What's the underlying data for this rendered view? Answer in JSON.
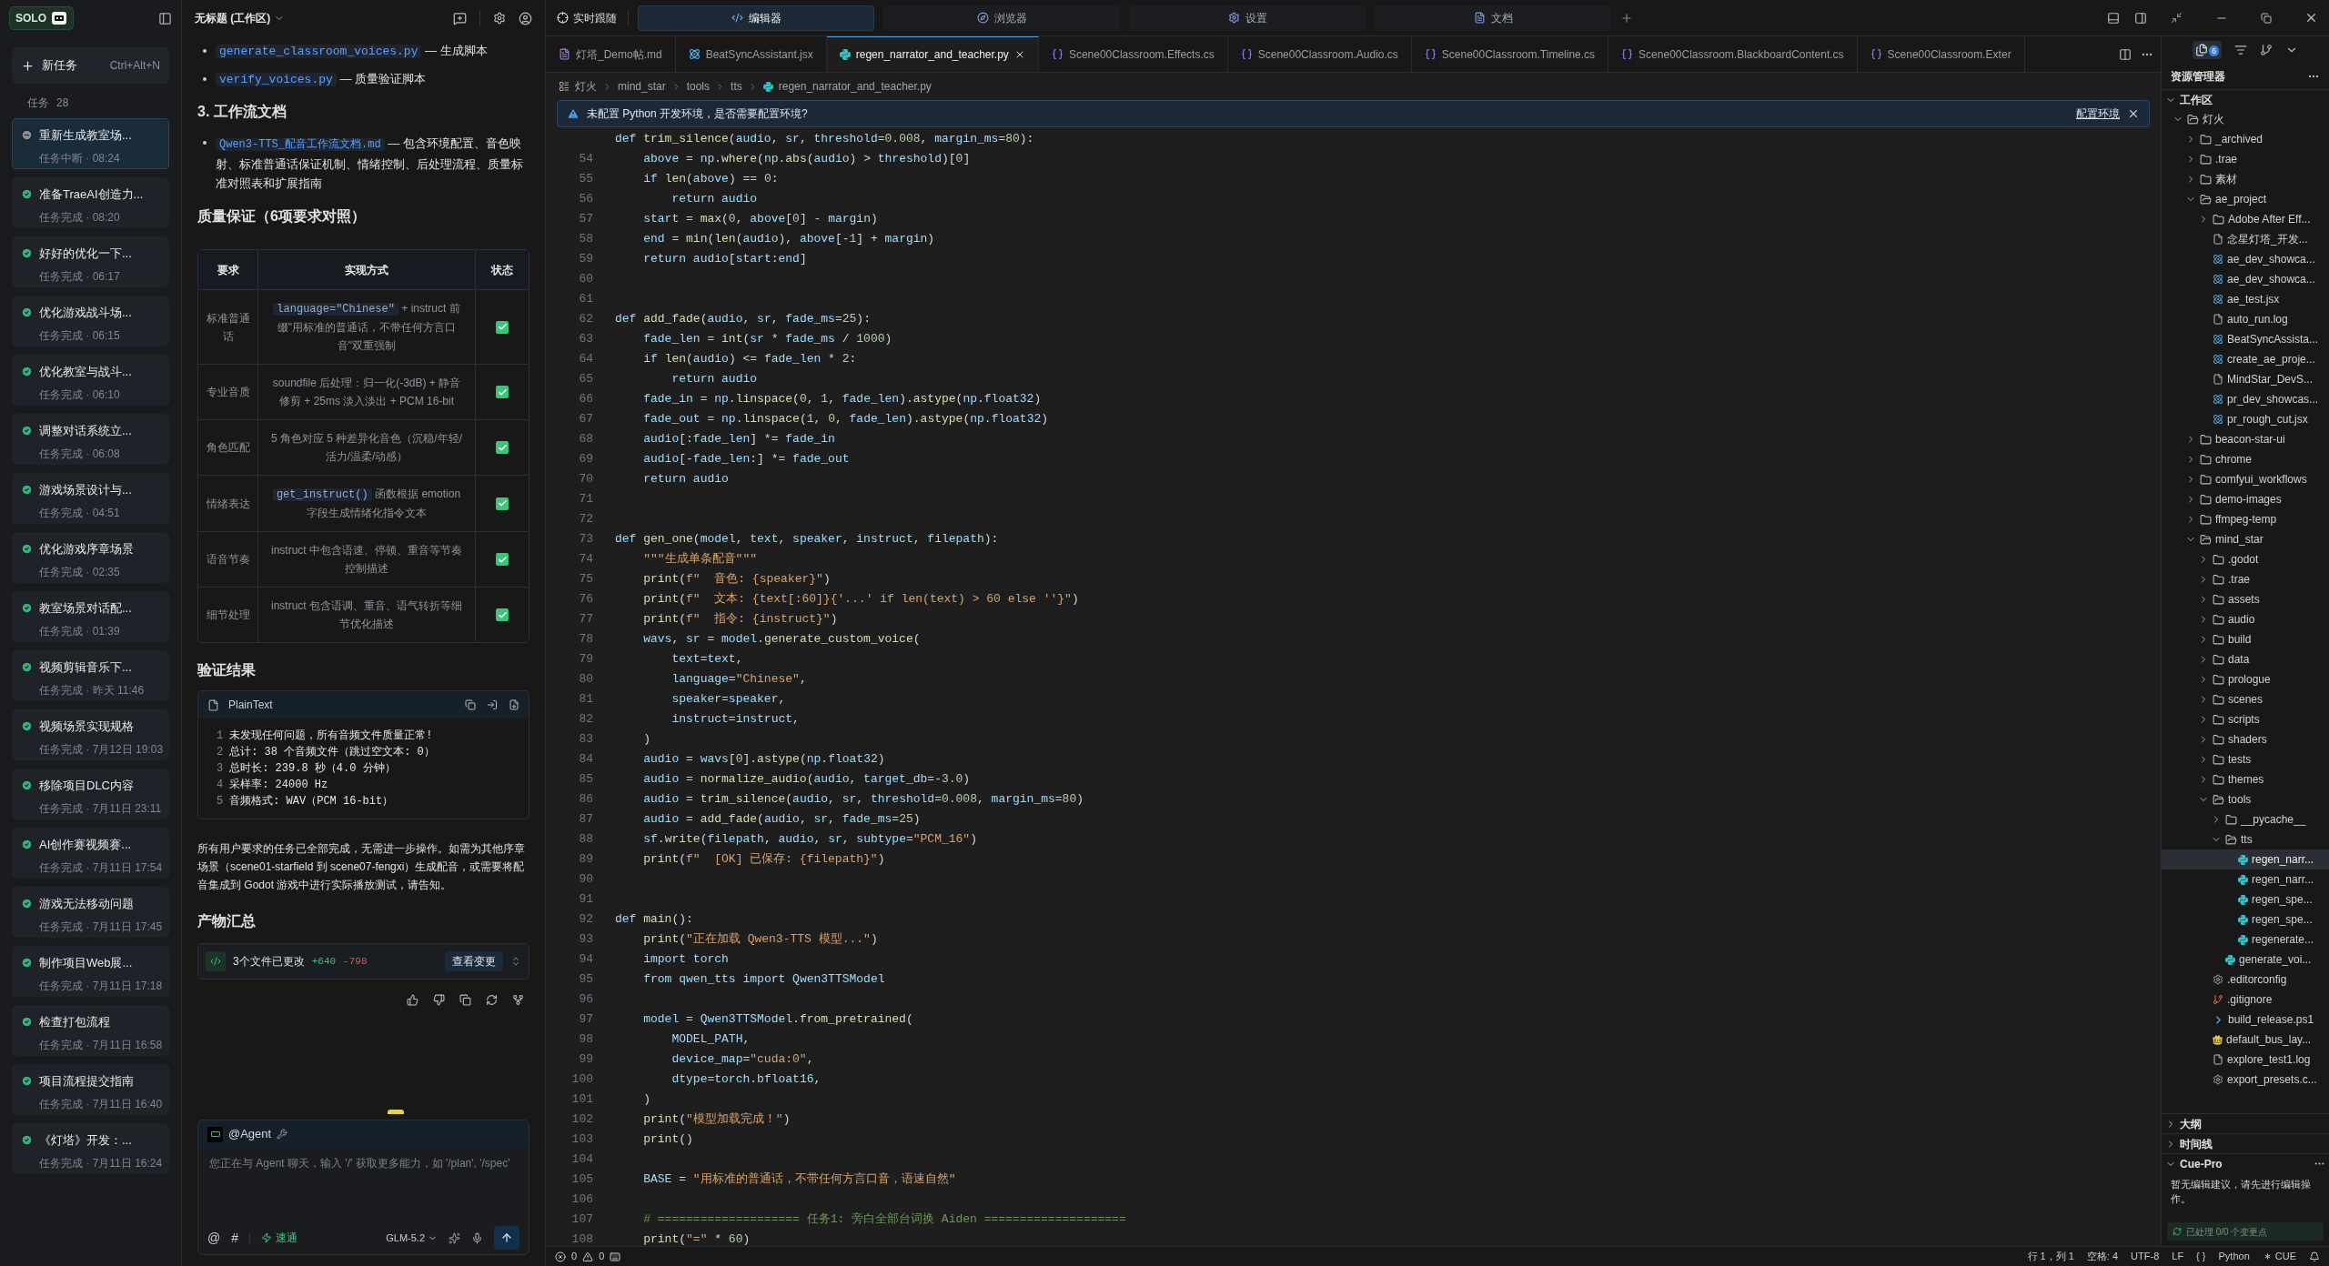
{
  "sidebar": {
    "logo": "SOLO",
    "new_task": {
      "label": "新任务",
      "shortcut": "Ctrl+Alt+N"
    },
    "tasks_label": "任务",
    "tasks_count": "28",
    "tasks": [
      {
        "title": "重新生成教室场...",
        "subtitle": "任务中断 · 08:24",
        "kind": "interrupted",
        "selected": true
      },
      {
        "title": "准备TraeAI创造力...",
        "subtitle": "任务完成 · 08:20",
        "kind": "done",
        "selected": false
      },
      {
        "title": "好好的优化一下...",
        "subtitle": "任务完成 · 06:17",
        "kind": "done",
        "selected": false
      },
      {
        "title": "优化游戏战斗场...",
        "subtitle": "任务完成 · 06:15",
        "kind": "done",
        "selected": false
      },
      {
        "title": "优化教室与战斗...",
        "subtitle": "任务完成 · 06:10",
        "kind": "done",
        "selected": false
      },
      {
        "title": "调整对话系统立...",
        "subtitle": "任务完成 · 06:08",
        "kind": "done",
        "selected": false
      },
      {
        "title": "游戏场景设计与...",
        "subtitle": "任务完成 · 04:51",
        "kind": "done",
        "selected": false
      },
      {
        "title": "优化游戏序章场景",
        "subtitle": "任务完成 · 02:35",
        "kind": "done",
        "selected": false
      },
      {
        "title": "教室场景对话配...",
        "subtitle": "任务完成 · 01:39",
        "kind": "done",
        "selected": false
      },
      {
        "title": "视频剪辑音乐下...",
        "subtitle": "任务完成 · 昨天 11:46",
        "kind": "done",
        "selected": false
      },
      {
        "title": "视频场景实现规格",
        "subtitle": "任务完成 · 7月12日 19:03",
        "kind": "done",
        "selected": false
      },
      {
        "title": "移除项目DLC内容",
        "subtitle": "任务完成 · 7月11日 23:11",
        "kind": "done",
        "selected": false
      },
      {
        "title": "AI创作赛视频赛...",
        "subtitle": "任务完成 · 7月11日 17:54",
        "kind": "done",
        "selected": false
      },
      {
        "title": "游戏无法移动问题",
        "subtitle": "任务完成 · 7月11日 17:45",
        "kind": "done",
        "selected": false
      },
      {
        "title": "制作项目Web展...",
        "subtitle": "任务完成 · 7月11日 17:18",
        "kind": "done",
        "selected": false
      },
      {
        "title": "检查打包流程",
        "subtitle": "任务完成 · 7月11日 16:58",
        "kind": "done",
        "selected": false
      },
      {
        "title": "项目流程提交指南",
        "subtitle": "任务完成 · 7月11日 16:40",
        "kind": "done",
        "selected": false
      },
      {
        "title": "《灯塔》开发：...",
        "subtitle": "任务完成 · 7月11日 16:24",
        "kind": "done",
        "selected": false
      }
    ]
  },
  "chat": {
    "title": "无标题 (工作区)",
    "script_bullets": [
      {
        "code": "generate_classroom_voices.py",
        "text": "— 生成脚本"
      },
      {
        "code": "verify_voices.py",
        "text": "— 质量验证脚本"
      }
    ],
    "docs_heading": "3. 工作流文档",
    "doc_bullets": [
      {
        "code": "Qwen3-TTS_配音工作流文档.md",
        "text": "— 包含环境配置、音色映射、标准普通话保证机制、情绪控制、后处理流程、质量标准对照表和扩展指南"
      }
    ],
    "qa_heading": "质量保证（6项要求对照）",
    "table": {
      "columns": [
        "要求",
        "实现方式",
        "状态"
      ],
      "rows": [
        {
          "requirement": "标准普通话",
          "code": "language=\"Chinese\"",
          "method": " + instruct 前缀\"用标准的普通话，不带任何方言口音\"双重强制",
          "checked": true
        },
        {
          "requirement": "专业音质",
          "method": "soundfile 后处理：归一化(-3dB) + 静音修剪 + 25ms 淡入淡出 + PCM 16-bit",
          "checked": true
        },
        {
          "requirement": "角色匹配",
          "method": "5 角色对应 5 种差异化音色（沉稳/年轻/活力/温柔/动感）",
          "checked": true
        },
        {
          "requirement": "情绪表达",
          "code": "get_instruct()",
          "method": " 函数根据 emotion 字段生成情绪化指令文本",
          "checked": true
        },
        {
          "requirement": "语音节奏",
          "method": "instruct 中包含语速、停顿、重音等节奏控制描述",
          "checked": true
        },
        {
          "requirement": "细节处理",
          "method": "instruct 包含语调、重音、语气转折等细节优化描述",
          "checked": true
        }
      ]
    },
    "verify_heading": "验证结果",
    "code_block": {
      "language": "PlainText",
      "lines": [
        {
          "number": "1",
          "text": "未发现任何问题，所有音频文件质量正常!"
        },
        {
          "number": "2",
          "text": "总计: 38 个音频文件（跳过空文本: 0）"
        },
        {
          "number": "3",
          "text": "总时长: 239.8 秒（4.0 分钟）"
        },
        {
          "number": "4",
          "text": "采样率: 24000 Hz"
        },
        {
          "number": "5",
          "text": "音频格式: WAV（PCM 16-bit）"
        }
      ]
    },
    "summary": "所有用户要求的任务已全部完成，无需进一步操作。如需为其他序章场景（scene01-starfield 到 scene07-fengxi）生成配音，或需要将配音集成到 Godot 游戏中进行实际播放测试，请告知。",
    "artifacts_heading": "产物汇总",
    "changes": {
      "label": "3个文件已更改",
      "added": "+640",
      "removed": "-798",
      "button": "查看变更"
    },
    "composer": {
      "agent": "@Agent",
      "placeholder": "您正在与 Agent 聊天，输入 '/' 获取更多能力，如 '/plan', '/spec'",
      "at": "@",
      "hash": "#",
      "mode": "速通",
      "model": "GLM-5.2"
    }
  },
  "editor": {
    "follow": "实时跟随",
    "top_tabs": [
      {
        "label": "编辑器",
        "kind": "editor",
        "selected": true
      },
      {
        "label": "浏览器",
        "kind": "browser",
        "selected": false
      },
      {
        "label": "设置",
        "kind": "settings",
        "selected": false
      },
      {
        "label": "文档",
        "kind": "docs",
        "selected": false
      }
    ],
    "file_tabs": [
      {
        "label": "灯塔_Demo帖.md",
        "kind": "md",
        "selected": false
      },
      {
        "label": "BeatSyncAssistant.jsx",
        "kind": "react",
        "selected": false
      },
      {
        "label": "regen_narrator_and_teacher.py",
        "kind": "python",
        "selected": true
      },
      {
        "label": "Scene00Classroom.Effects.cs",
        "kind": "csharp",
        "selected": false
      },
      {
        "label": "Scene00Classroom.Audio.cs",
        "kind": "csharp",
        "selected": false
      },
      {
        "label": "Scene00Classroom.Timeline.cs",
        "kind": "csharp",
        "selected": false
      },
      {
        "label": "Scene00Classroom.BlackboardContent.cs",
        "kind": "csharp",
        "selected": false
      },
      {
        "label": "Scene00Classroom.Exter",
        "kind": "csharp",
        "selected": false
      }
    ],
    "breadcrumb": [
      "灯火",
      "mind_star",
      "tools",
      "tts",
      "regen_narrator_and_teacher.py"
    ],
    "banner": {
      "message": "未配置 Python 开发环境，是否需要配置环境?",
      "action": "配置环境"
    },
    "lines": [
      {
        "text": "def trim_silence(audio, sr, threshold=0.008, margin_ms=80):"
      },
      {
        "number": "54",
        "text": "    above = np.where(np.abs(audio) > threshold)[0]"
      },
      {
        "number": "55",
        "text": "    if len(above) == 0:"
      },
      {
        "number": "56",
        "text": "        return audio"
      },
      {
        "number": "57",
        "text": "    start = max(0, above[0] - margin)"
      },
      {
        "number": "58",
        "text": "    end = min(len(audio), above[-1] + margin)"
      },
      {
        "number": "59",
        "text": "    return audio[start:end]"
      },
      {
        "number": "60"
      },
      {
        "number": "61"
      },
      {
        "number": "62",
        "text": "def add_fade(audio, sr, fade_ms=25):"
      },
      {
        "number": "63",
        "text": "    fade_len = int(sr * fade_ms / 1000)"
      },
      {
        "number": "64",
        "text": "    if len(audio) <= fade_len * 2:"
      },
      {
        "number": "65",
        "text": "        return audio"
      },
      {
        "number": "66",
        "text": "    fade_in = np.linspace(0, 1, fade_len).astype(np.float32)"
      },
      {
        "number": "67",
        "text": "    fade_out = np.linspace(1, 0, fade_len).astype(np.float32)"
      },
      {
        "number": "68",
        "text": "    audio[:fade_len] *= fade_in"
      },
      {
        "number": "69",
        "text": "    audio[-fade_len:] *= fade_out"
      },
      {
        "number": "70",
        "text": "    return audio"
      },
      {
        "number": "71"
      },
      {
        "number": "72"
      },
      {
        "number": "73",
        "text": "def gen_one(model, text, speaker, instruct, filepath):"
      },
      {
        "number": "74",
        "text": "    \"\"\"生成单条配音\"\"\""
      },
      {
        "number": "75",
        "text": "    print(f\"  音色: {speaker}\")"
      },
      {
        "number": "76",
        "text": "    print(f\"  文本: {text[:60]}{'...' if len(text) > 60 else ''}\")"
      },
      {
        "number": "77",
        "text": "    print(f\"  指令: {instruct}\")"
      },
      {
        "number": "78",
        "text": "    wavs, sr = model.generate_custom_voice("
      },
      {
        "number": "79",
        "text": "        text=text,"
      },
      {
        "number": "80",
        "text": "        language=\"Chinese\","
      },
      {
        "number": "81",
        "text": "        speaker=speaker,"
      },
      {
        "number": "82",
        "text": "        instruct=instruct,"
      },
      {
        "number": "83",
        "text": "    )"
      },
      {
        "number": "84",
        "text": "    audio = wavs[0].astype(np.float32)"
      },
      {
        "number": "85",
        "text": "    audio = normalize_audio(audio, target_db=-3.0)"
      },
      {
        "number": "86",
        "text": "    audio = trim_silence(audio, sr, threshold=0.008, margin_ms=80)"
      },
      {
        "number": "87",
        "text": "    audio = add_fade(audio, sr, fade_ms=25)"
      },
      {
        "number": "88",
        "text": "    sf.write(filepath, audio, sr, subtype=\"PCM_16\")"
      },
      {
        "number": "89",
        "text": "    print(f\"  [OK] 已保存: {filepath}\")"
      },
      {
        "number": "90"
      },
      {
        "number": "91"
      },
      {
        "number": "92",
        "text": "def main():"
      },
      {
        "number": "93",
        "text": "    print(\"正在加载 Qwen3-TTS 模型...\")"
      },
      {
        "number": "94",
        "text": "    import torch"
      },
      {
        "number": "95",
        "text": "    from qwen_tts import Qwen3TTSModel"
      },
      {
        "number": "96"
      },
      {
        "number": "97",
        "text": "    model = Qwen3TTSModel.from_pretrained("
      },
      {
        "number": "98",
        "text": "        MODEL_PATH,"
      },
      {
        "number": "99",
        "text": "        device_map=\"cuda:0\","
      },
      {
        "number": "100",
        "text": "        dtype=torch.bfloat16,"
      },
      {
        "number": "101",
        "text": "    )"
      },
      {
        "number": "102",
        "text": "    print(\"模型加载完成！\")"
      },
      {
        "number": "103",
        "text": "    print()"
      },
      {
        "number": "104"
      },
      {
        "number": "105",
        "text": "    BASE = \"用标准的普通话，不带任何方言口音，语速自然\""
      },
      {
        "number": "106"
      },
      {
        "number": "107",
        "text": "    # ==================== 任务1: 旁白全部台词换 Aiden ===================="
      },
      {
        "number": "108",
        "text": "    print(\"=\" * 60)"
      }
    ]
  },
  "explorer": {
    "badge": "6",
    "title": "资源管理器",
    "sections": [
      {
        "label": "工作区",
        "expanded": true,
        "items": [
          {
            "name": "灯火",
            "kind": "folder",
            "expanded": true,
            "selected": false,
            "children": [
              {
                "name": "_archived",
                "kind": "folder",
                "expanded": false,
                "selected": false
              },
              {
                "name": ".trae",
                "kind": "folder",
                "expanded": false,
                "selected": false
              },
              {
                "name": "素材",
                "kind": "folder",
                "expanded": false,
                "selected": false
              },
              {
                "name": "ae_project",
                "kind": "folder",
                "expanded": true,
                "selected": false,
                "children": [
                  {
                    "name": "Adobe After Eff...",
                    "kind": "folder",
                    "expanded": false,
                    "selected": false
                  },
                  {
                    "name": "念星灯塔_开发...",
                    "kind": "file",
                    "selected": false
                  },
                  {
                    "name": "ae_dev_showca...",
                    "kind": "react",
                    "selected": false
                  },
                  {
                    "name": "ae_dev_showca...",
                    "kind": "react",
                    "selected": false
                  },
                  {
                    "name": "ae_test.jsx",
                    "kind": "react",
                    "selected": false
                  },
                  {
                    "name": "auto_run.log",
                    "kind": "file",
                    "selected": false
                  },
                  {
                    "name": "BeatSyncAssista...",
                    "kind": "react",
                    "selected": false
                  },
                  {
                    "name": "create_ae_proje...",
                    "kind": "react",
                    "selected": false
                  },
                  {
                    "name": "MindStar_DevS...",
                    "kind": "file",
                    "selected": false
                  },
                  {
                    "name": "pr_dev_showcas...",
                    "kind": "react",
                    "selected": false
                  },
                  {
                    "name": "pr_rough_cut.jsx",
                    "kind": "react",
                    "selected": false
                  }
                ]
              },
              {
                "name": "beacon-star-ui",
                "kind": "folder",
                "expanded": false,
                "selected": false
              },
              {
                "name": "chrome",
                "kind": "folder",
                "expanded": false,
                "selected": false
              },
              {
                "name": "comfyui_workflows",
                "kind": "folder",
                "expanded": false,
                "selected": false
              },
              {
                "name": "demo-images",
                "kind": "folder",
                "expanded": false,
                "selected": false
              },
              {
                "name": "ffmpeg-temp",
                "kind": "folder",
                "expanded": false,
                "selected": false
              },
              {
                "name": "mind_star",
                "kind": "folder",
                "expanded": true,
                "selected": false,
                "children": [
                  {
                    "name": ".godot",
                    "kind": "folder",
                    "expanded": false,
                    "selected": false
                  },
                  {
                    "name": ".trae",
                    "kind": "folder",
                    "expanded": false,
                    "selected": false
                  },
                  {
                    "name": "assets",
                    "kind": "folder",
                    "expanded": false,
                    "selected": false
                  },
                  {
                    "name": "audio",
                    "kind": "folder",
                    "expanded": false,
                    "selected": false
                  },
                  {
                    "name": "build",
                    "kind": "folder",
                    "expanded": false,
                    "selected": false
                  },
                  {
                    "name": "data",
                    "kind": "folder",
                    "expanded": false,
                    "selected": false
                  },
                  {
                    "name": "prologue",
                    "kind": "folder",
                    "expanded": false,
                    "selected": false
                  },
                  {
                    "name": "scenes",
                    "kind": "folder",
                    "expanded": false,
                    "selected": false
                  },
                  {
                    "name": "scripts",
                    "kind": "folder",
                    "expanded": false,
                    "selected": false
                  },
                  {
                    "name": "shaders",
                    "kind": "folder",
                    "expanded": false,
                    "selected": false
                  },
                  {
                    "name": "tests",
                    "kind": "folder",
                    "expanded": false,
                    "selected": false
                  },
                  {
                    "name": "themes",
                    "kind": "folder",
                    "expanded": false,
                    "selected": false
                  },
                  {
                    "name": "tools",
                    "kind": "folder",
                    "expanded": true,
                    "selected": false,
                    "children": [
                      {
                        "name": "__pycache__",
                        "kind": "folder",
                        "expanded": false,
                        "selected": false
                      },
                      {
                        "name": "tts",
                        "kind": "folder",
                        "expanded": true,
                        "selected": false,
                        "children": [
                          {
                            "name": "regen_narr...",
                            "kind": "python",
                            "selected": true
                          },
                          {
                            "name": "regen_narr...",
                            "kind": "python",
                            "selected": false
                          },
                          {
                            "name": "regen_spe...",
                            "kind": "python",
                            "selected": false
                          },
                          {
                            "name": "regen_spe...",
                            "kind": "python",
                            "selected": false
                          },
                          {
                            "name": "regenerate...",
                            "kind": "python",
                            "selected": false
                          }
                        ]
                      },
                      {
                        "name": "generate_voi...",
                        "kind": "python",
                        "selected": false
                      }
                    ]
                  },
                  {
                    "name": ".editorconfig",
                    "kind": "gear",
                    "selected": false
                  },
                  {
                    "name": ".gitignore",
                    "kind": "git",
                    "selected": false
                  },
                  {
                    "name": "build_release.ps1",
                    "kind": "terminal",
                    "selected": false
                  },
                  {
                    "name": "default_bus_lay...",
                    "kind": "godot",
                    "selected": false
                  },
                  {
                    "name": "explore_test1.log",
                    "kind": "file",
                    "selected": false
                  },
                  {
                    "name": "export_presets.c...",
                    "kind": "gear",
                    "selected": false
                  }
                ]
              }
            ]
          }
        ]
      },
      {
        "label": "大纲",
        "expanded": false
      },
      {
        "label": "时间线",
        "expanded": false
      },
      {
        "label": "Cue-Pro",
        "expanded": true,
        "message": "暂无编辑建议，请先进行编辑操作。",
        "status": "已处理 0/0 个变更点"
      }
    ]
  },
  "status_bar": {
    "errors": "0",
    "warnings": "0",
    "position": "行 1，列 1",
    "indent": "空格: 4",
    "encoding": "UTF-8",
    "eol": "LF",
    "braces": "{ }",
    "language": "Python",
    "cue": "CUE"
  }
}
